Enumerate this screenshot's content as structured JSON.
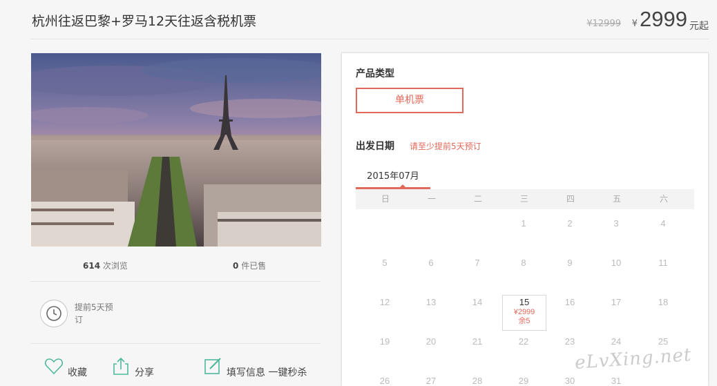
{
  "product": {
    "title": "杭州往返巴黎+罗马12天往返含税机票",
    "original_price": "¥12999",
    "currency": "¥",
    "price": "2999",
    "price_suffix": "元起"
  },
  "stats": {
    "views_count": "614",
    "views_label": "次浏览",
    "sold_count": "0",
    "sold_label": "件已售"
  },
  "advance_notice": "提前5天预订",
  "actions": {
    "favorite": "收藏",
    "share": "分享",
    "fill_info": "填写信息 一键秒杀"
  },
  "booking": {
    "product_type_label": "产品类型",
    "product_type_option": "单机票",
    "date_label": "出发日期",
    "date_tip": "请至少提前5天预订",
    "month": "2015年07月",
    "weekdays": [
      "日",
      "一",
      "二",
      "三",
      "四",
      "五",
      "六"
    ],
    "active_day": {
      "day": "15",
      "price": "¥2999",
      "remaining": "余5"
    }
  },
  "colors": {
    "accent": "#e0695a",
    "green_icon": "#4cb89a"
  },
  "watermark": "eLvXing.net"
}
